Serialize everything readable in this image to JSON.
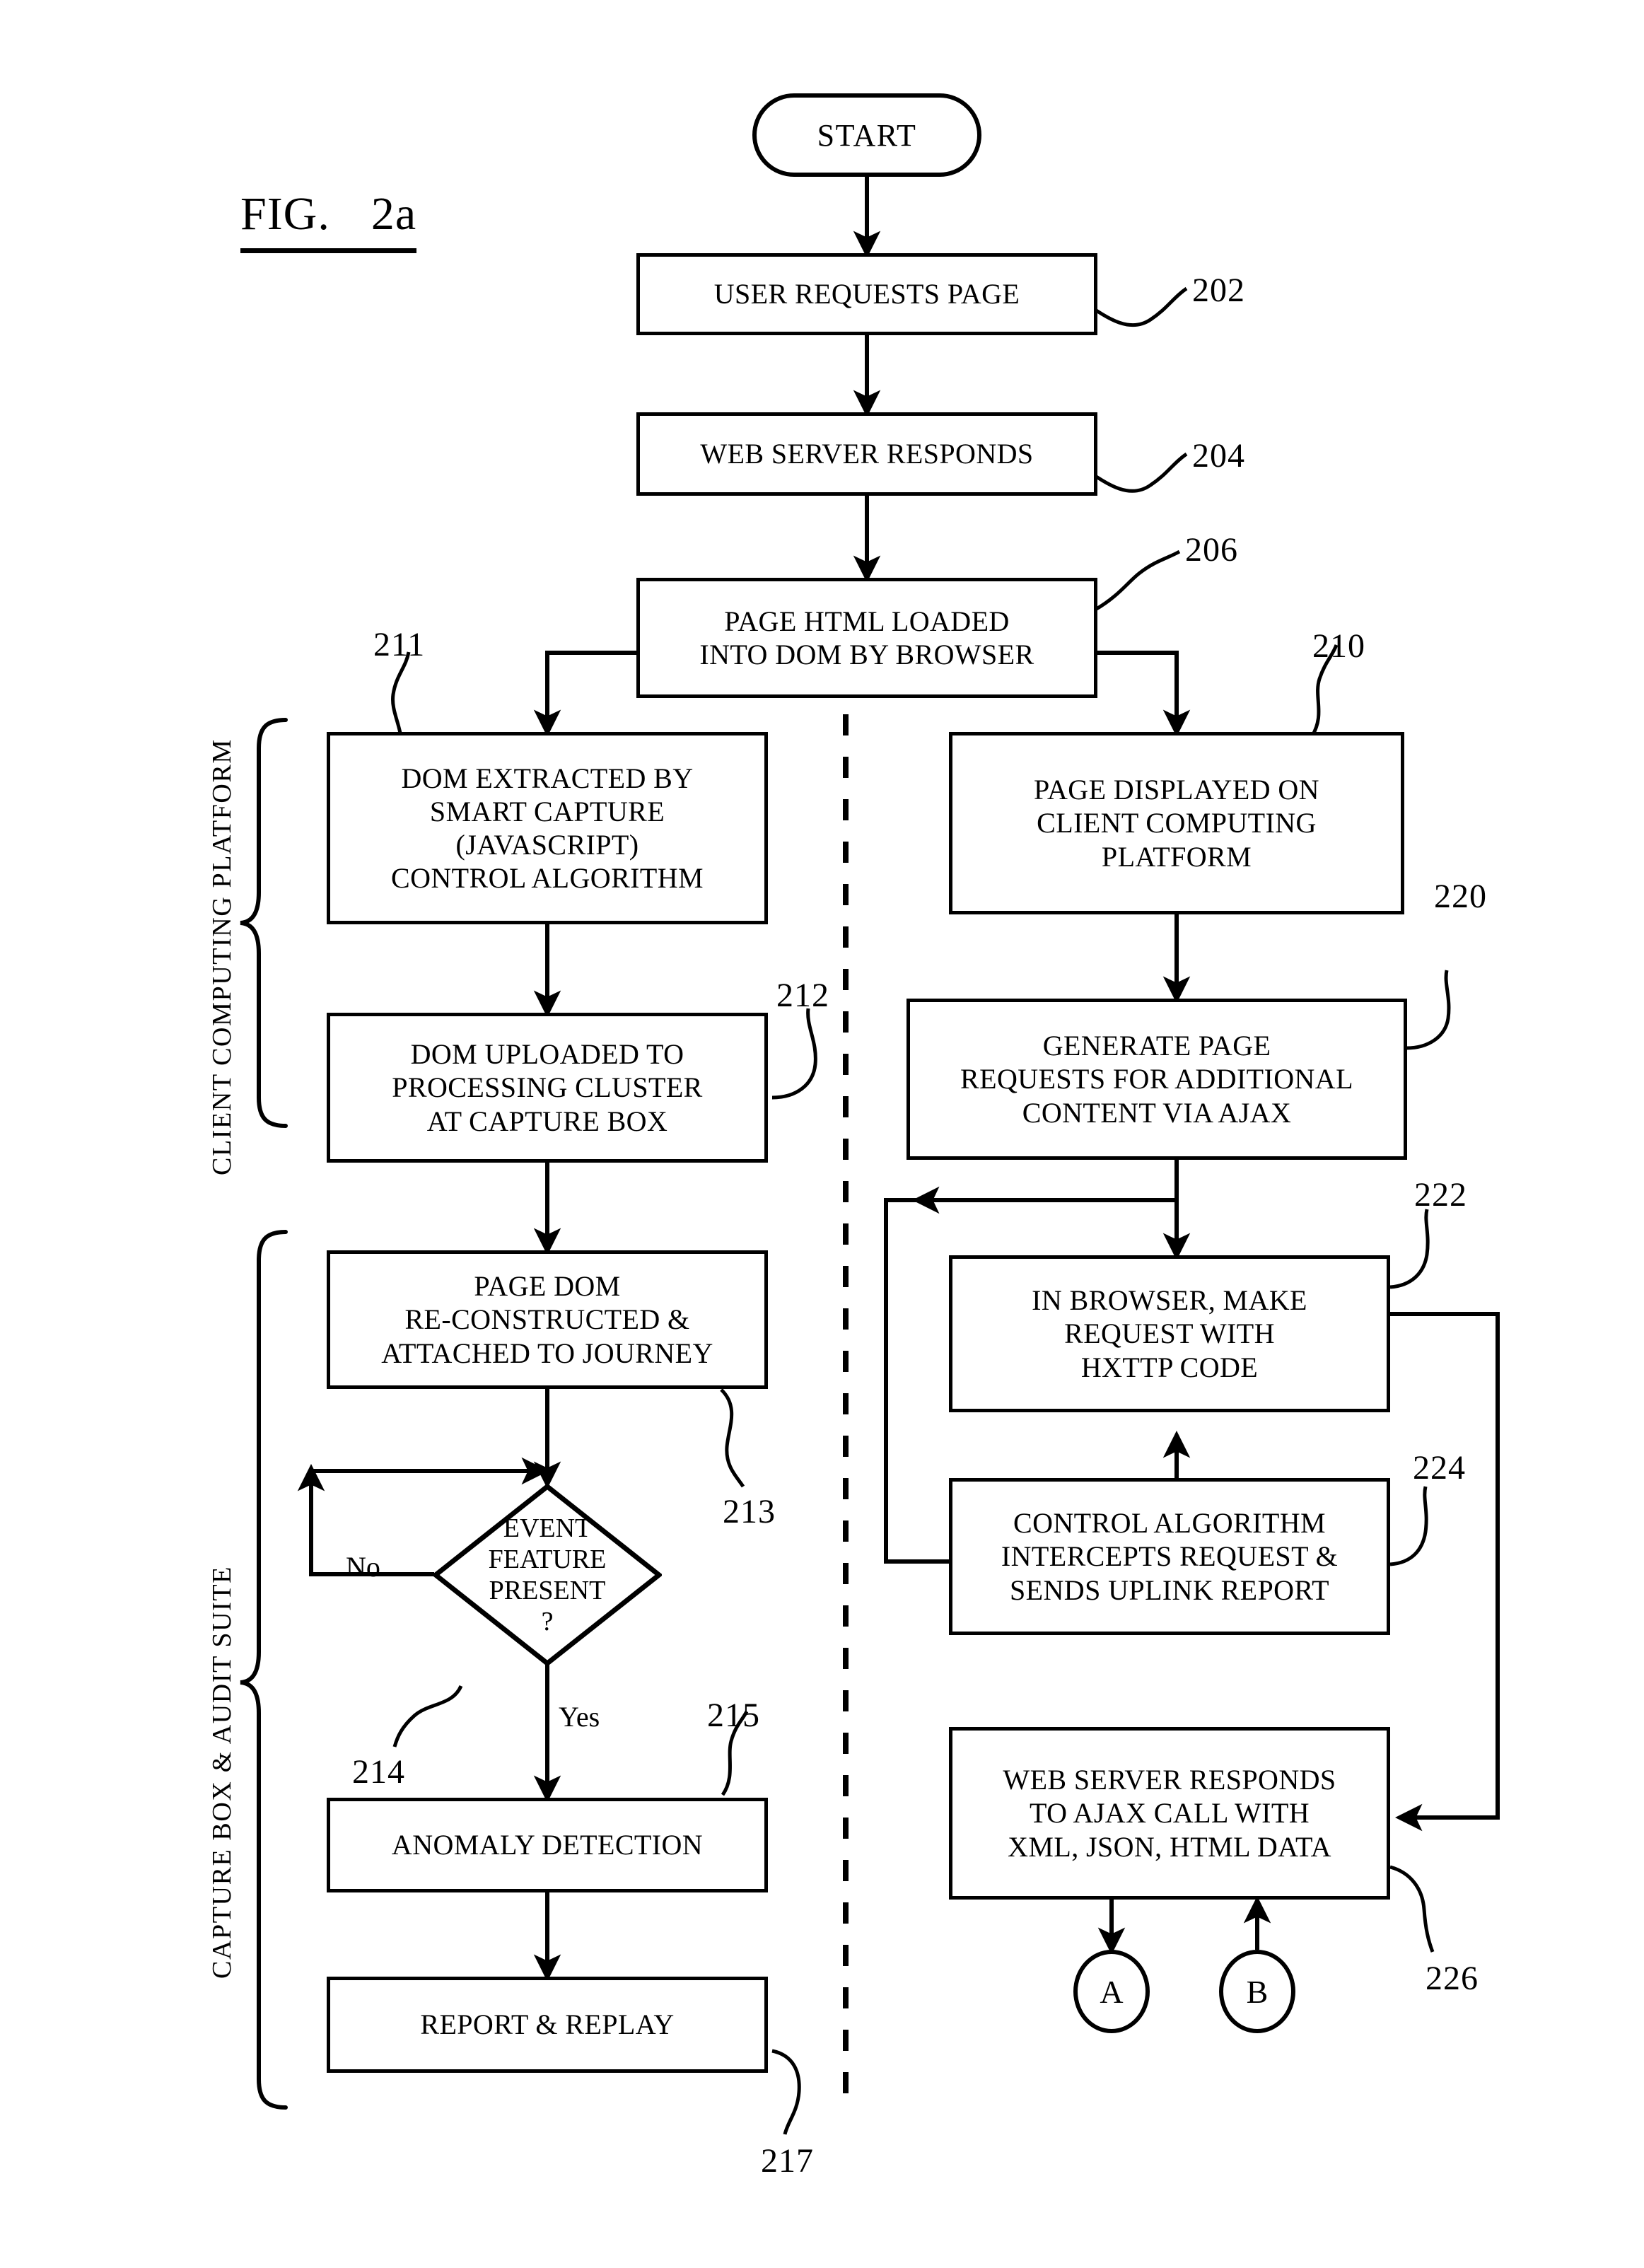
{
  "figure": {
    "label": "FIG.",
    "number": "2a"
  },
  "side_labels": {
    "upper": "CLIENT COMPUTING PLATFORM",
    "lower": "CAPTURE BOX & AUDIT SUITE"
  },
  "nodes": {
    "start": {
      "text": "START"
    },
    "user_requests_page": {
      "text": "USER REQUESTS PAGE",
      "ref": "202"
    },
    "web_server_responds": {
      "text": "WEB SERVER RESPONDS",
      "ref": "204"
    },
    "page_html_loaded": {
      "line1": "PAGE HTML LOADED",
      "line2": "INTO DOM BY BROWSER",
      "ref": "206"
    },
    "dom_extracted": {
      "line1": "DOM EXTRACTED BY",
      "line2": "SMART CAPTURE",
      "line3": "(JAVASCRIPT)",
      "line4": "CONTROL ALGORITHM",
      "ref": "211"
    },
    "dom_uploaded": {
      "line1": "DOM UPLOADED TO",
      "line2": "PROCESSING CLUSTER",
      "line3": "AT CAPTURE BOX",
      "ref": "212"
    },
    "page_dom_reconstructed": {
      "line1": "PAGE DOM",
      "line2": "RE-CONSTRUCTED &",
      "line3": "ATTACHED TO JOURNEY",
      "ref": "213"
    },
    "event_feature_decision": {
      "line1": "EVENT",
      "line2": "FEATURE",
      "line3": "PRESENT",
      "line4": "?",
      "ref": "214",
      "no_label": "No",
      "yes_label": "Yes"
    },
    "anomaly_detection": {
      "text": "ANOMALY DETECTION",
      "ref": "215"
    },
    "report_replay": {
      "text": "REPORT & REPLAY",
      "ref": "217"
    },
    "page_displayed": {
      "line1": "PAGE DISPLAYED ON",
      "line2": "CLIENT COMPUTING",
      "line3": "PLATFORM",
      "ref": "210"
    },
    "generate_page_requests": {
      "line1": "GENERATE PAGE",
      "line2": "REQUESTS FOR ADDITIONAL",
      "line3": "CONTENT VIA AJAX",
      "ref": "220"
    },
    "in_browser_make_request": {
      "line1": "IN BROWSER, MAKE",
      "line2": "REQUEST WITH",
      "line3": "HXTTP CODE",
      "ref": "222"
    },
    "control_algorithm_intercepts": {
      "line1": "CONTROL ALGORITHM",
      "line2": "INTERCEPTS REQUEST &",
      "line3": "SENDS UPLINK REPORT",
      "ref": "224"
    },
    "web_server_ajax": {
      "line1": "WEB SERVER RESPONDS",
      "line2": "TO AJAX CALL WITH",
      "line3": "XML, JSON, HTML DATA",
      "ref": "226"
    },
    "connector_a": {
      "text": "A"
    },
    "connector_b": {
      "text": "B"
    }
  },
  "colors": {
    "stroke": "#000000",
    "background": "#ffffff"
  }
}
